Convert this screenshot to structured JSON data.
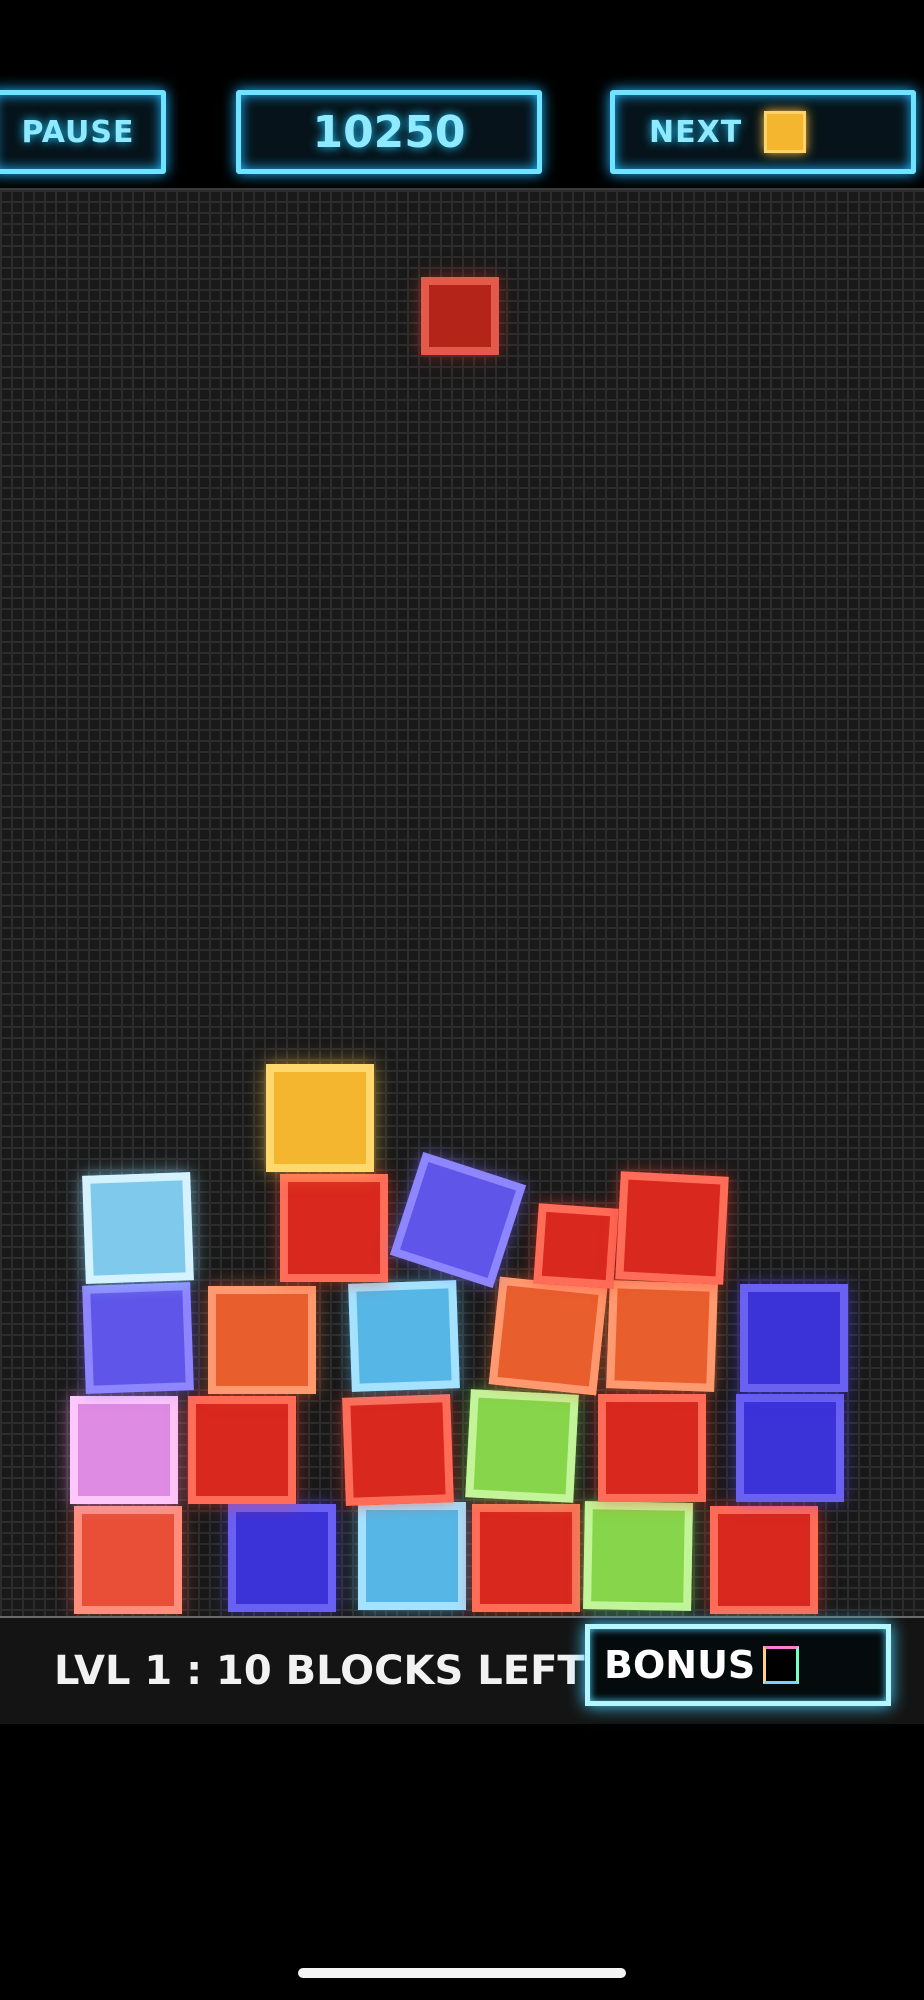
{
  "hud": {
    "pause_label": "PAUSE",
    "score": "10250",
    "next_label": "NEXT",
    "next_block_color": "#f3b62e"
  },
  "status": {
    "level_text": "LVL 1 :  10 BLOCKS LEFT",
    "bonus_label": "BONUS"
  },
  "falling_block": {
    "color": "red"
  },
  "stack_blocks": [
    {
      "color": "salmon"
    },
    {
      "color": "blue"
    },
    {
      "color": "sky"
    },
    {
      "color": "red"
    },
    {
      "color": "green"
    },
    {
      "color": "red"
    },
    {
      "color": "pink"
    },
    {
      "color": "red"
    },
    {
      "color": "red"
    },
    {
      "color": "green"
    },
    {
      "color": "red"
    },
    {
      "color": "blue"
    },
    {
      "color": "violet"
    },
    {
      "color": "orange"
    },
    {
      "color": "sky"
    },
    {
      "color": "orange"
    },
    {
      "color": "orange"
    },
    {
      "color": "blue"
    },
    {
      "color": "ice"
    },
    {
      "color": "red"
    },
    {
      "color": "violet"
    },
    {
      "color": "red"
    },
    {
      "color": "red"
    },
    {
      "color": "yellow"
    }
  ]
}
